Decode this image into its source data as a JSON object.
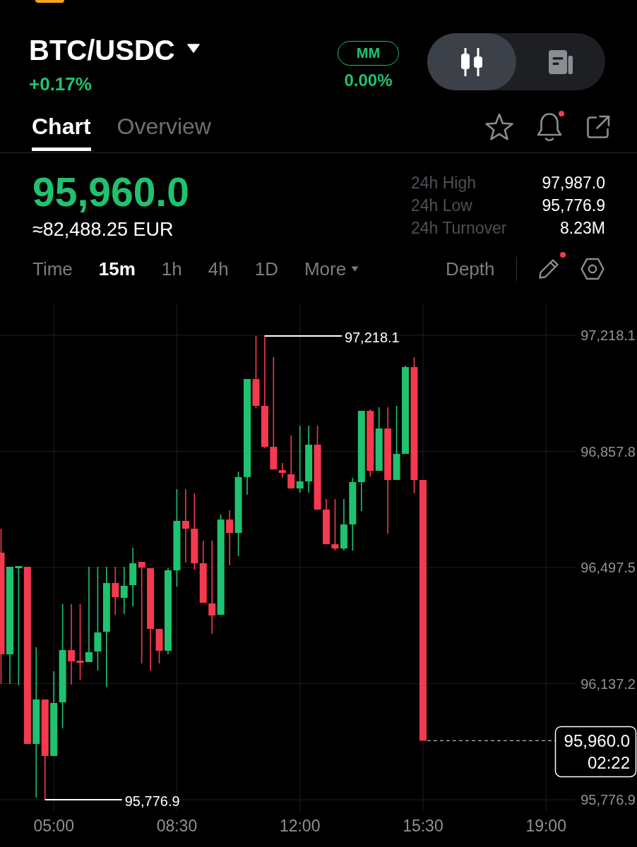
{
  "header": {
    "symbol": "BTC/USDC",
    "change": "+0.17%",
    "mm": {
      "label": "MM",
      "value": "0.00%"
    },
    "view_toggle": [
      {
        "kind": "candles",
        "selected": true
      },
      {
        "kind": "document",
        "selected": false
      }
    ]
  },
  "tabs": [
    {
      "label": "Chart",
      "selected": true
    },
    {
      "label": "Overview",
      "selected": false
    }
  ],
  "tab_actions": [
    {
      "kind": "star",
      "dot": false
    },
    {
      "kind": "bell",
      "dot": true
    },
    {
      "kind": "share",
      "dot": false
    }
  ],
  "price": {
    "last": "95,960.0",
    "fiat": "≈82,488.25 EUR",
    "stats": [
      {
        "label": "24h High",
        "value": "97,987.0"
      },
      {
        "label": "24h Low",
        "value": "95,776.9"
      },
      {
        "label": "24h Turnover",
        "value": "8.23M"
      }
    ]
  },
  "intervals": [
    {
      "label": "Time",
      "kind": "option",
      "selected": false
    },
    {
      "label": "15m",
      "kind": "option",
      "selected": true
    },
    {
      "label": "1h",
      "kind": "option",
      "selected": false
    },
    {
      "label": "4h",
      "kind": "option",
      "selected": false
    },
    {
      "label": "1D",
      "kind": "option",
      "selected": false
    },
    {
      "label": "More",
      "kind": "menu",
      "selected": false
    }
  ],
  "chart_tools": {
    "depth": "Depth",
    "tools": [
      {
        "kind": "pencil",
        "dot": true
      },
      {
        "kind": "settings",
        "dot": false
      }
    ]
  },
  "chart": {
    "chart_data": {
      "type": "candlestick",
      "grid": true,
      "x": [
        3.5,
        3.75,
        4,
        4.25,
        4.5,
        4.75,
        5,
        5.25,
        5.5,
        5.75,
        6,
        6.25,
        6.5,
        6.75,
        7,
        7.25,
        7.5,
        7.75,
        8,
        8.25,
        8.5,
        8.75,
        9,
        9.25,
        9.5,
        9.75,
        10,
        10.25,
        10.5,
        10.75,
        11,
        11.25,
        11.5,
        11.75,
        12,
        12.25,
        12.5,
        12.75,
        13,
        13.25,
        13.5,
        13.75,
        14,
        14.25,
        14.5,
        14.75,
        15,
        15.25,
        15.5
      ],
      "ohlc": [
        [
          96543.5,
          96618.0,
          96136.1,
          96228.1
        ],
        [
          96228.1,
          96499.7,
          96136.1,
          96499.7
        ],
        [
          96495.3,
          96501.9,
          96131.7,
          96501.9
        ],
        [
          96499.7,
          96499.7,
          95949.9,
          95949.9
        ],
        [
          95949.9,
          96250.0,
          95783.5,
          96087.9
        ],
        [
          96087.9,
          96087.9,
          95776.9,
          95912.7
        ],
        [
          95912.7,
          96175.5,
          95912.7,
          96077.0
        ],
        [
          96079.2,
          96383.6,
          95998.1,
          96241.2
        ],
        [
          96241.2,
          96383.6,
          96133.9,
          96206.2
        ],
        [
          96208.4,
          96383.6,
          96149.2,
          96201.8
        ],
        [
          96204.0,
          96499.7,
          96204.0,
          96234.7
        ],
        [
          96236.9,
          96499.7,
          96177.7,
          96296.0
        ],
        [
          96298.2,
          96499.7,
          96127.3,
          96449.3
        ],
        [
          96449.3,
          96499.7,
          96350.8,
          96405.5
        ],
        [
          96403.3,
          96499.7,
          96352.9,
          96440.6
        ],
        [
          96442.7,
          96558.8,
          96377.0,
          96510.6
        ],
        [
          96515.0,
          96515.0,
          96199.6,
          96497.5
        ],
        [
          96495.3,
          96495.3,
          96177.7,
          96307.0
        ],
        [
          96307.0,
          96307.0,
          96199.6,
          96239.1
        ],
        [
          96239.1,
          96495.3,
          96228.1,
          96488.7
        ],
        [
          96488.7,
          96740.6,
          96438.4,
          96642.1
        ],
        [
          96642.1,
          96740.6,
          96512.8,
          96618.0
        ],
        [
          96618.0,
          96727.5,
          96490.9,
          96510.6
        ],
        [
          96510.6,
          96580.7,
          96388.0,
          96388.0
        ],
        [
          96385.8,
          96580.7,
          96291.6,
          96348.6
        ],
        [
          96350.8,
          96661.8,
          96350.8,
          96646.4
        ],
        [
          96646.4,
          96674.9,
          96504.1,
          96604.8
        ],
        [
          96604.8,
          96795.4,
          96532.6,
          96777.9
        ],
        [
          96777.9,
          97082.3,
          96723.1,
          97082.3
        ],
        [
          97082.3,
          97215.9,
          96992.5,
          96999.1
        ],
        [
          96999.1,
          97218.1,
          96867.7,
          96872.0
        ],
        [
          96872.0,
          97150.2,
          96802.0,
          96802.0
        ],
        [
          96799.8,
          96821.7,
          96775.7,
          96791.0
        ],
        [
          96786.6,
          96907.1,
          96742.8,
          96742.8
        ],
        [
          96742.8,
          96937.7,
          96729.7,
          96764.7
        ],
        [
          96764.7,
          96937.7,
          96729.7,
          96878.6
        ],
        [
          96878.6,
          96937.7,
          96677.1,
          96677.1
        ],
        [
          96677.1,
          96710.0,
          96569.8,
          96569.8
        ],
        [
          96569.8,
          96710.0,
          96550.1,
          96556.6
        ],
        [
          96556.6,
          96710.0,
          96550.1,
          96631.1
        ],
        [
          96631.1,
          96775.7,
          96550.1,
          96762.5
        ],
        [
          96762.5,
          96983.7,
          96672.7,
          96983.7
        ],
        [
          96983.7,
          96988.1,
          96780.0,
          96797.6
        ],
        [
          96797.6,
          96994.7,
          96797.6,
          96929.0
        ],
        [
          96929.0,
          96994.7,
          96602.6,
          96769.1
        ],
        [
          96769.1,
          96999.1,
          96769.1,
          96850.1
        ],
        [
          96850.1,
          97123.9,
          96850.1,
          97119.5
        ],
        [
          97119.5,
          97150.2,
          96727.5,
          96769.1
        ],
        [
          96769.1,
          96769.1,
          95960.0,
          95960.0
        ]
      ],
      "xlim": [
        3.47,
        19.84
      ],
      "ylim": [
        95739.7,
        97316.7
      ],
      "xticks": [
        {
          "value": 5,
          "label": "05:00"
        },
        {
          "value": 8.5,
          "label": "08:30"
        },
        {
          "value": 12,
          "label": "12:00"
        },
        {
          "value": 15.5,
          "label": "15:30"
        },
        {
          "value": 19,
          "label": "19:00"
        }
      ],
      "yticks": [
        {
          "value": 97218.1,
          "label": "97,218.1"
        },
        {
          "value": 96857.8,
          "label": "96,857.8"
        },
        {
          "value": 96497.5,
          "label": "96,497.5"
        },
        {
          "value": 96137.2,
          "label": "96,137.2"
        },
        {
          "value": 95776.9,
          "label": "95,776.9"
        }
      ]
    },
    "high_label": "97,218.1",
    "low_label": "95,776.9",
    "last_price": "95,960.0",
    "countdown": "02:22"
  }
}
